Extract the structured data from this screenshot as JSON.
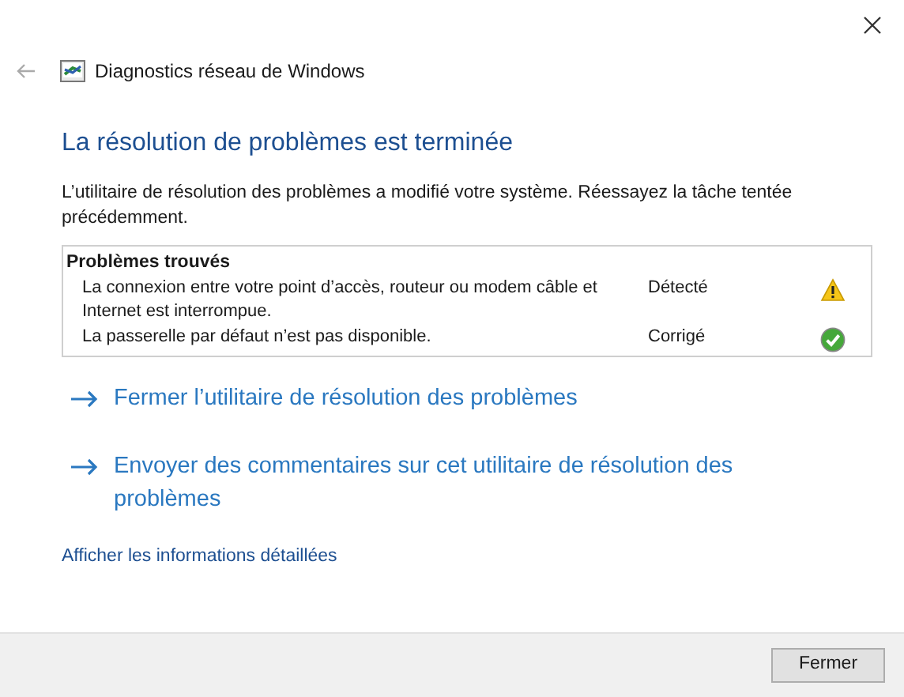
{
  "window": {
    "title": "Diagnostics réseau de Windows"
  },
  "heading": "La résolution de problèmes est terminée",
  "message": "L’utilitaire de résolution des problèmes a modifié votre système. Réessayez la tâche tentée précédemment.",
  "problems": {
    "title": "Problèmes trouvés",
    "rows": [
      {
        "description": "La connexion entre votre point d’accès, routeur ou modem câble et Internet est interrompue.",
        "status": "Détecté",
        "kind": "warning"
      },
      {
        "description": "La passerelle par défaut n’est pas disponible.",
        "status": "Corrigé",
        "kind": "fixed"
      }
    ]
  },
  "actions": [
    "Fermer l’utilitaire de résolution des problèmes",
    "Envoyer des commentaires sur cet utilitaire de résolution des problèmes"
  ],
  "details_link": "Afficher les informations détaillées",
  "buttons": [
    "Fermer"
  ]
}
